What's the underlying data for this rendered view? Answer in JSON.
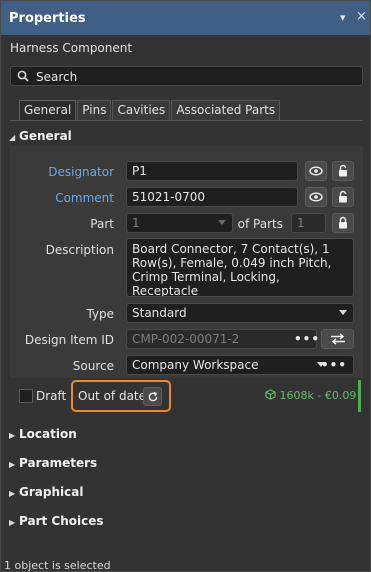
{
  "titlebar": {
    "title": "Properties",
    "pin_glyph": "▾",
    "close_glyph": "×"
  },
  "subtitle": "Harness Component",
  "search": {
    "placeholder": "Search"
  },
  "tabs": [
    {
      "label": "General"
    },
    {
      "label": "Pins"
    },
    {
      "label": "Cavities"
    },
    {
      "label": "Associated Parts"
    }
  ],
  "general": {
    "heading": "General",
    "designator": {
      "label": "Designator",
      "value": "P1"
    },
    "comment": {
      "label": "Comment",
      "value": "51021-0700"
    },
    "part": {
      "label": "Part",
      "value": "1",
      "of_parts_label": "of Parts",
      "of_parts_value": "1"
    },
    "description": {
      "label": "Description",
      "value": "Board Connector, 7 Contact(s), 1 Row(s), Female, 0.049 inch Pitch, Crimp Terminal, Locking, Receptacle"
    },
    "type": {
      "label": "Type",
      "value": "Standard"
    },
    "design_item_id": {
      "label": "Design Item ID",
      "value": "CMP-002-00071-2"
    },
    "source": {
      "label": "Source",
      "value": "Company Workspace"
    },
    "ellipsis": "•••"
  },
  "status": {
    "draft_label": "Draft",
    "state_label": "Out of date",
    "price": "1608k - €0.09"
  },
  "sections": [
    {
      "label": "Location"
    },
    {
      "label": "Parameters"
    },
    {
      "label": "Graphical"
    },
    {
      "label": "Part Choices"
    }
  ],
  "footer": "1 object is selected",
  "colors": {
    "titlebar": "#3f5f86",
    "link_label": "#6aa9e8",
    "highlight": "#f08a24",
    "price": "#5fbf6a"
  }
}
